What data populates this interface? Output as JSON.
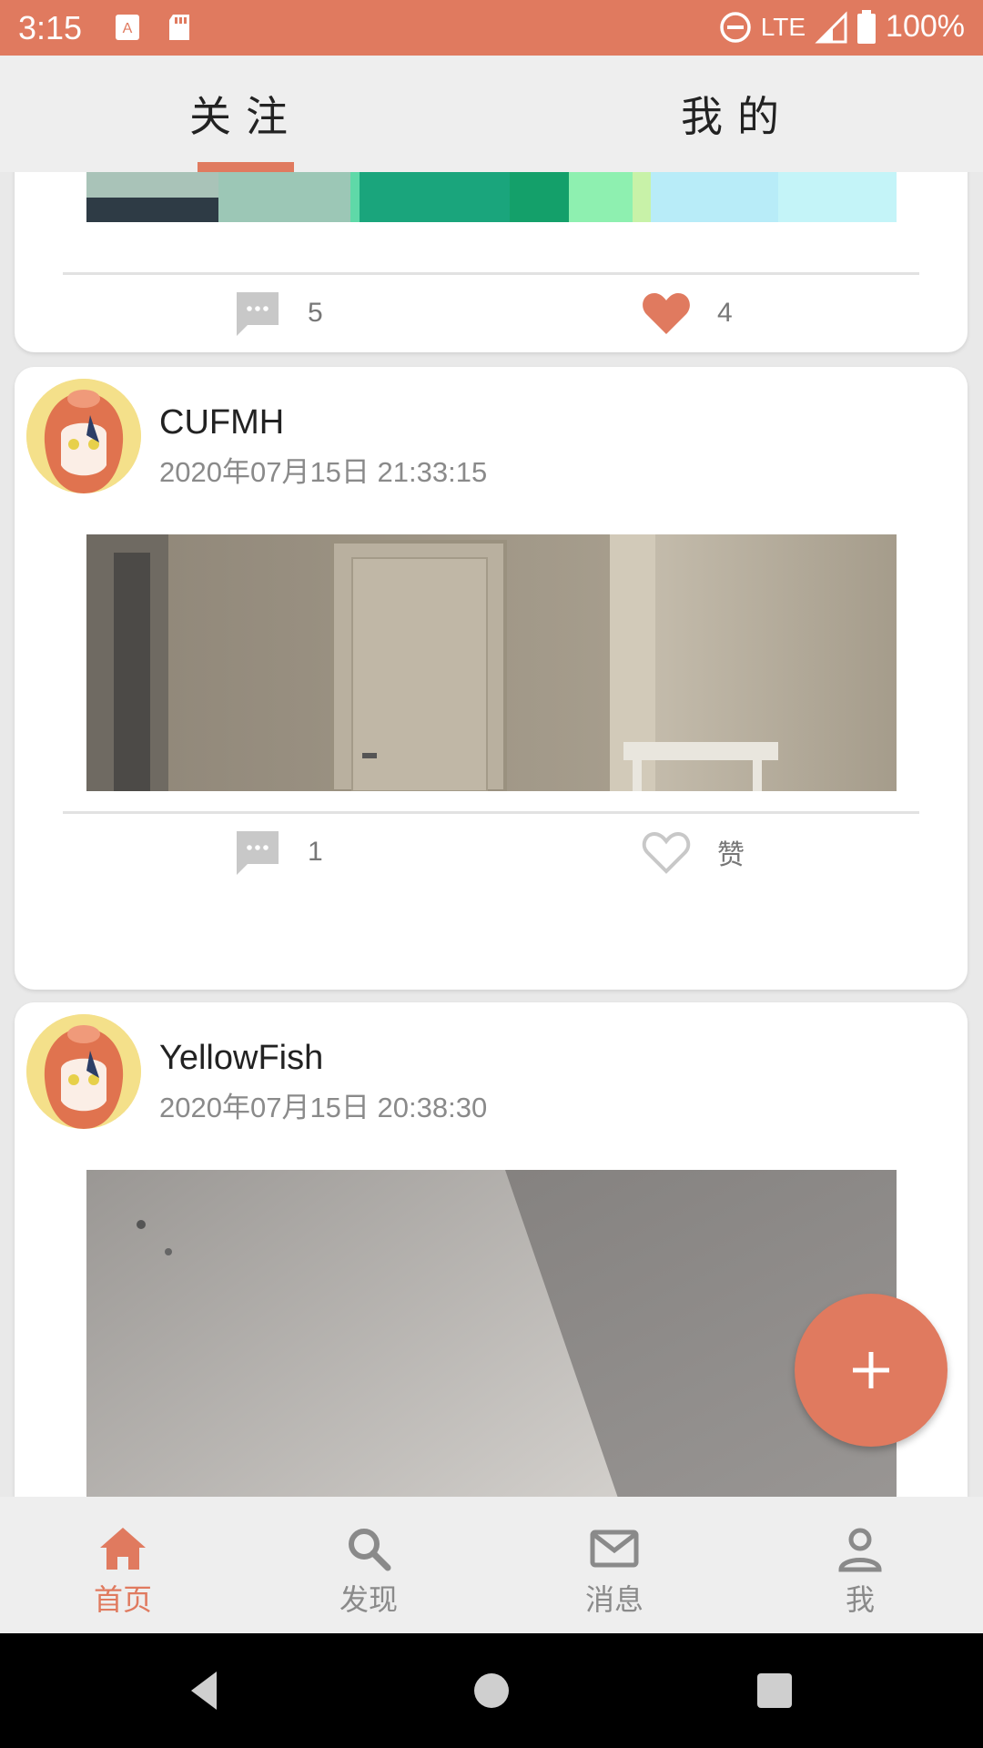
{
  "status_bar": {
    "time": "3:15",
    "network": "LTE",
    "battery": "100%",
    "icons": [
      "keyboard-icon",
      "sd-card-icon",
      "do-not-disturb-icon",
      "signal-icon",
      "battery-icon"
    ]
  },
  "top_tabs": [
    {
      "label": "关注",
      "active": true
    },
    {
      "label": "我的",
      "active": false
    }
  ],
  "feed": {
    "prev_post": {
      "comments": "5",
      "likes": "4",
      "liked": true
    },
    "posts": [
      {
        "username": "CUFMH",
        "timestamp": "2020年07月15日 21:33:15",
        "comments": "1",
        "like_label": "赞",
        "liked": false
      },
      {
        "username": "YellowFish",
        "timestamp": "2020年07月15日 20:38:30"
      }
    ]
  },
  "fab": {
    "icon": "plus-icon"
  },
  "bottom_nav": [
    {
      "label": "首页",
      "icon": "home-icon",
      "active": true
    },
    {
      "label": "发现",
      "icon": "search-icon",
      "active": false
    },
    {
      "label": "消息",
      "icon": "mail-icon",
      "active": false
    },
    {
      "label": "我",
      "icon": "person-icon",
      "active": false
    }
  ],
  "colors": {
    "accent": "#e07a5f",
    "text_dark": "#222222",
    "text_muted": "#8a8a8a"
  }
}
